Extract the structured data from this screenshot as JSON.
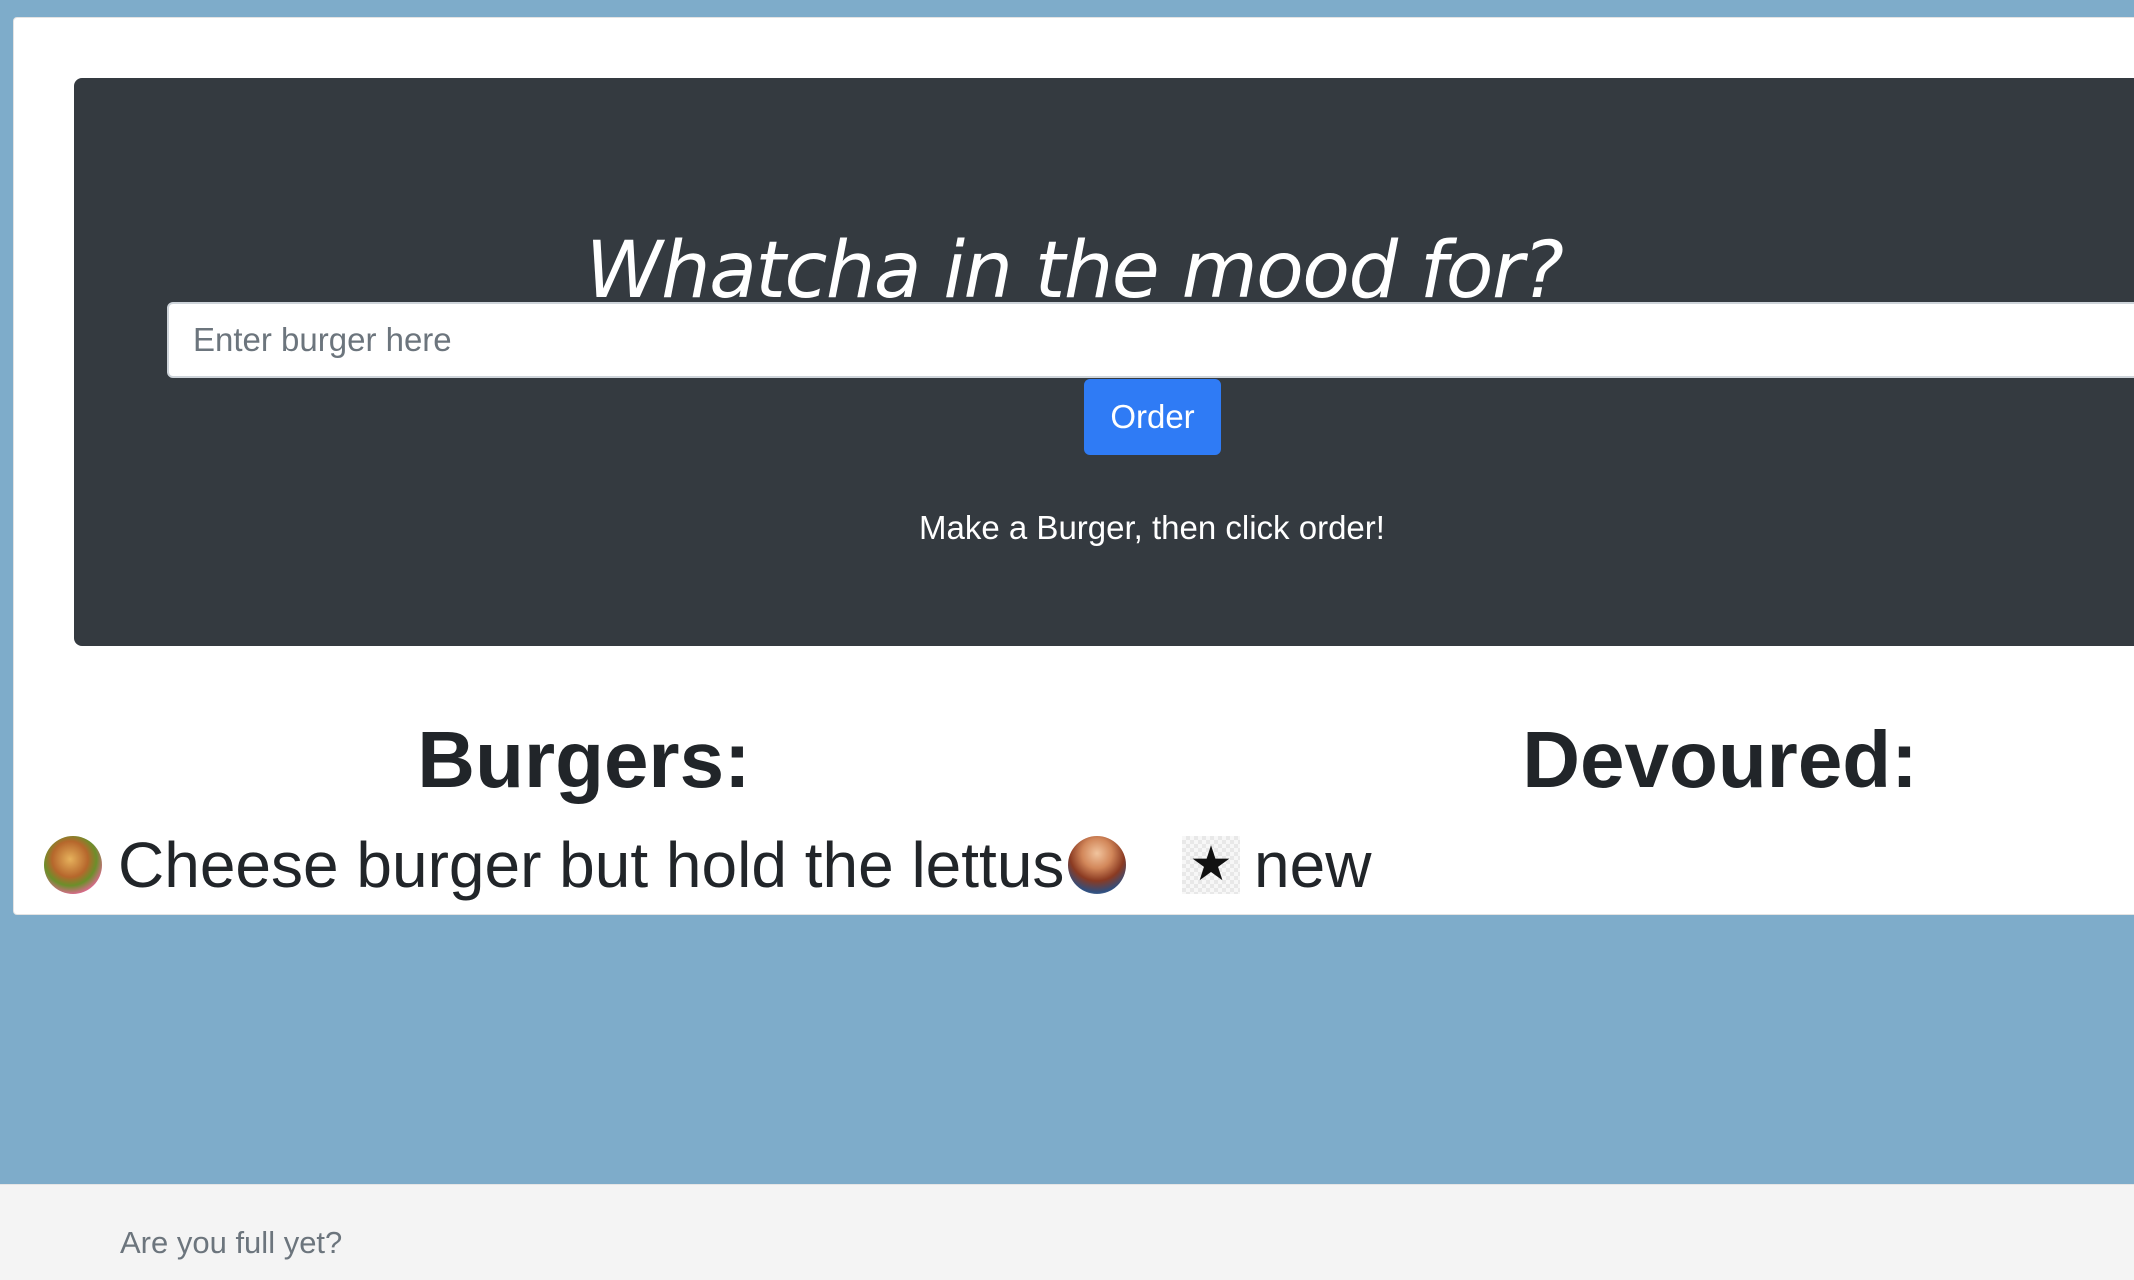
{
  "hero": {
    "title": "Whatcha in the mood for?",
    "input_placeholder": "Enter burger here",
    "input_value": "",
    "order_label": "Order",
    "instructions": "Make a Burger, then click order!"
  },
  "burgers": {
    "heading": "Burgers:",
    "items": [
      {
        "icon": "burger-icon",
        "name": "Cheese burger but hold the lettus",
        "action_icon": "devour-icon"
      },
      {
        "icon": "star-icon",
        "icon_glyph": "★",
        "name": "new"
      }
    ]
  },
  "devoured": {
    "heading": "Devoured:",
    "items": []
  },
  "footer": {
    "text": "Are you full yet?"
  },
  "colors": {
    "page_background": "#7eacca",
    "jumbotron": "#343a40",
    "primary_button": "#2f7bf5",
    "footer_background": "#f4f4f4"
  }
}
